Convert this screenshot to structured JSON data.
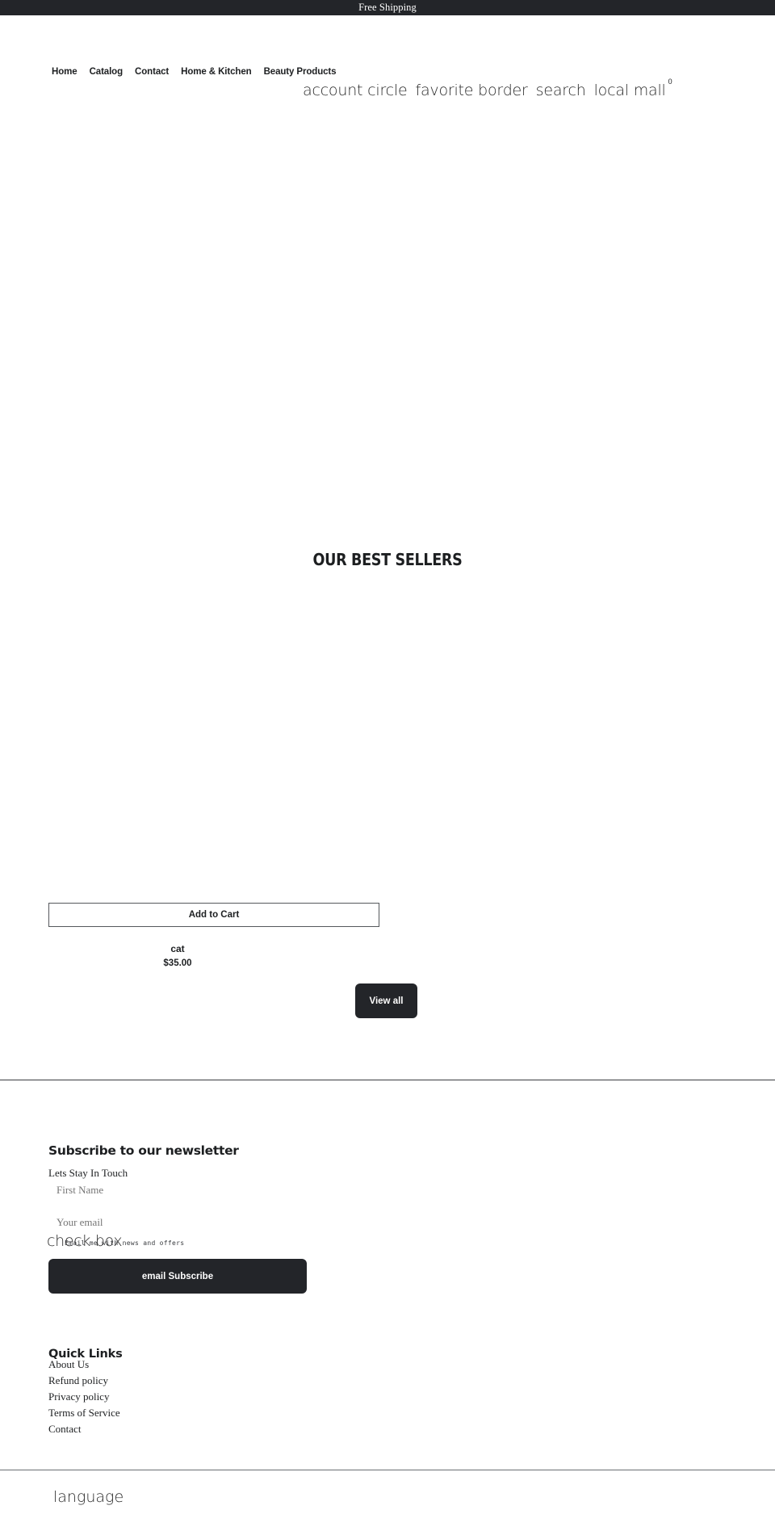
{
  "announcement": {
    "text": "Free Shipping"
  },
  "header": {
    "nav": [
      {
        "label": "Home"
      },
      {
        "label": "Catalog"
      },
      {
        "label": "Contact"
      },
      {
        "label": "Home & Kitchen"
      },
      {
        "label": "Beauty Products"
      }
    ],
    "icons": [
      {
        "name": "account-circle-icon",
        "ligature": "account circle"
      },
      {
        "name": "favorite-border-icon",
        "ligature": "favorite border"
      },
      {
        "name": "search-icon",
        "ligature": "search"
      },
      {
        "name": "local-mall-cart-icon",
        "ligature": "local mall"
      }
    ],
    "cart_count": "0"
  },
  "main": {
    "best_sellers_title": "OUR BEST SELLERS",
    "products": [
      {
        "title": "cat",
        "price": "$35.00",
        "add_to_cart_label": "Add to Cart"
      }
    ],
    "view_all_label": "View all"
  },
  "footer": {
    "newsletter": {
      "heading": "Subscribe to our newsletter",
      "subtext": "Lets Stay In Touch",
      "first_name_placeholder": "First Name",
      "first_name_value": "",
      "email_placeholder": "Your email",
      "email_value": "",
      "consent_checkbox_ligature": "check box",
      "consent_label": "Email me with news and offers",
      "subscribe_button_ligature": "email",
      "subscribe_button_label": "Subscribe"
    },
    "quick_links": {
      "heading": "Quick Links",
      "items": [
        {
          "label": "About Us"
        },
        {
          "label": "Refund policy"
        },
        {
          "label": "Privacy policy"
        },
        {
          "label": "Terms of Service"
        },
        {
          "label": "Contact"
        }
      ]
    },
    "language_selector_ligature": "language"
  },
  "colors": {
    "dark": "#232529",
    "page_background": "#ffffff",
    "text": "#1d1f21",
    "border": "#55585c"
  }
}
